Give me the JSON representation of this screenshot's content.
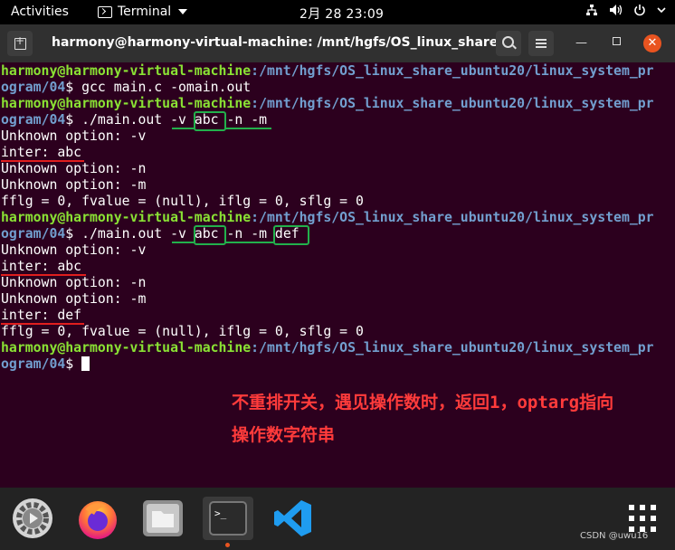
{
  "topbar": {
    "activities": "Activities",
    "app_name": "Terminal",
    "clock": "2月 28  23:09",
    "icons": [
      "network-icon",
      "volume-icon",
      "power-icon",
      "chevron-down-icon"
    ]
  },
  "window": {
    "title": "harmony@harmony-virtual-machine: /mnt/hgfs/OS_linux_share_...",
    "icons": [
      "new-tab-icon",
      "search-icon",
      "menu-icon",
      "minimize-icon",
      "maximize-icon",
      "close-icon"
    ]
  },
  "terminal": {
    "prompt_user": "harmony@harmony-virtual-machine",
    "prompt_path_1": ":/mnt/hgfs/OS_linux_share_ubuntu20/linux_system_pr",
    "prompt_path_2": "ogram/04",
    "prompt_sign": "$",
    "cmd1": " gcc main.c -omain.out",
    "cmd2": " ./main.out -v abc -n -m",
    "cmd3": " ./main.out -v abc -n -m def",
    "output1": [
      "Unknown option: -v",
      "inter: abc",
      "Unknown option: -n",
      "Unknown option: -m",
      "fflg = 0, fvalue = (null), iflg = 0, sflg = 0"
    ],
    "output2": [
      "Unknown option: -v",
      "inter: abc",
      "Unknown option: -n",
      "Unknown option: -m",
      "inter: def",
      "fflg = 0, fvalue = (null), iflg = 0, sflg = 0"
    ]
  },
  "annotation": {
    "line1": "不重排开关，遇见操作数时，返回1，optarg指向",
    "line2": "操作数字符串",
    "colors": {
      "green": "#22b14c",
      "red": "#e01e1e",
      "text": "#ff3b3b"
    }
  },
  "dock": {
    "items": [
      "settings-icon",
      "firefox-icon",
      "files-icon",
      "terminal-icon",
      "vscode-icon",
      "app-grid-icon"
    ]
  },
  "watermark": "CSDN @uwu16",
  "colors": {
    "terminal_bg": "#2c001e",
    "prompt_user": "#8ae234",
    "prompt_path": "#729fcf",
    "accent": "#e95420"
  }
}
